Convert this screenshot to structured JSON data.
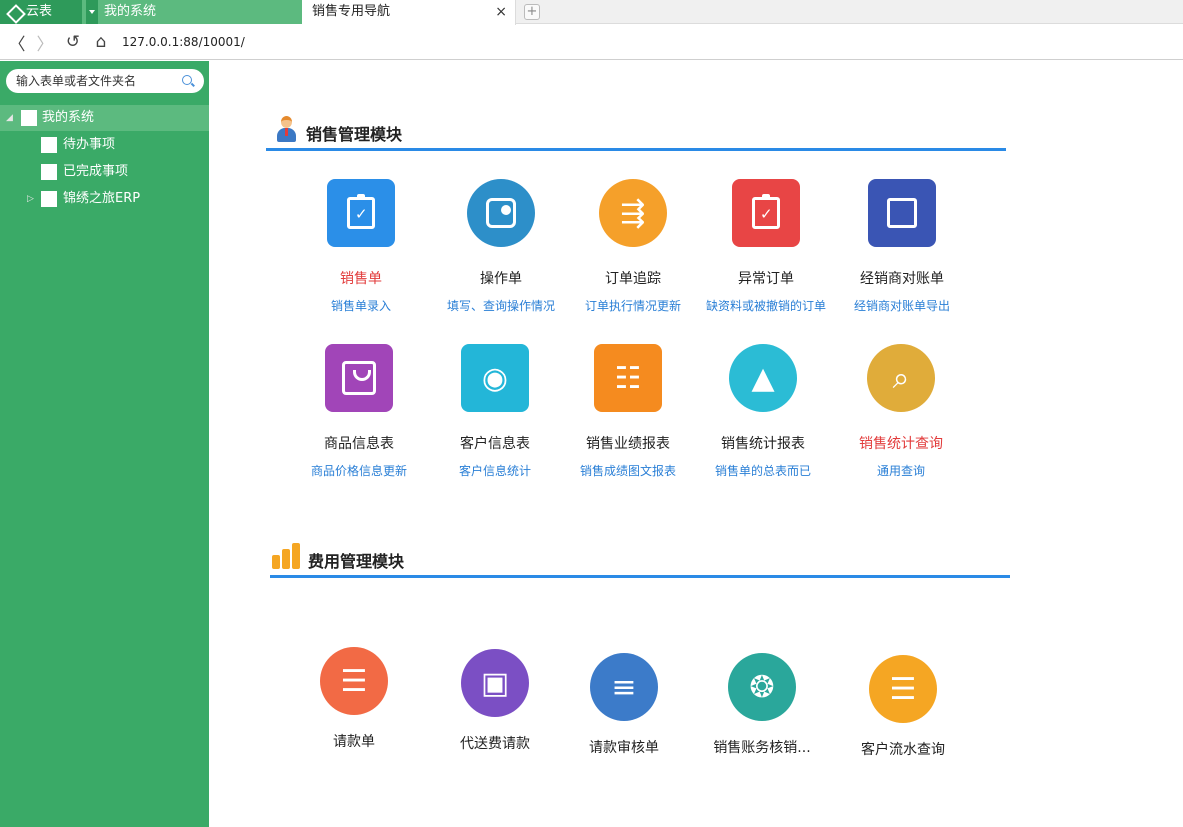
{
  "tabs": {
    "brand": "云表",
    "system_tab": "我的系统",
    "active_tab": "销售专用导航",
    "close_glyph": "×",
    "add_glyph": "+"
  },
  "address": {
    "url": "127.0.0.1:88/10001/"
  },
  "sidebar": {
    "search_placeholder": "输入表单或者文件夹名",
    "tree": [
      {
        "label": "我的系统"
      },
      {
        "label": "待办事项"
      },
      {
        "label": "已完成事项"
      },
      {
        "label": "锦绣之旅ERP"
      }
    ]
  },
  "sales_module": {
    "title": "销售管理模块",
    "tiles": [
      {
        "name": "销售单",
        "sub": "销售单录入",
        "icon": "clipboard-check-icon",
        "color": "#2b8fe8"
      },
      {
        "name": "操作单",
        "sub": "填写、查询操作情况",
        "icon": "user-card-icon",
        "color": "#2d8fc9"
      },
      {
        "name": "订单追踪",
        "sub": "订单执行情况更新",
        "icon": "running-man-icon",
        "color": "#f5a02a"
      },
      {
        "name": "异常订单",
        "sub": "缺资料或被撤销的订单",
        "icon": "return-note-icon",
        "color": "#e84545"
      },
      {
        "name": "经销商对账单",
        "sub": "经销商对账单导出",
        "icon": "document-search-icon",
        "color": "#3a55b4"
      },
      {
        "name": "商品信息表",
        "sub": "商品价格信息更新",
        "icon": "shopping-bag-icon",
        "color": "#a145b8"
      },
      {
        "name": "客户信息表",
        "sub": "客户信息统计",
        "icon": "customer-icon",
        "color": "#23b6d8"
      },
      {
        "name": "销售业绩报表",
        "sub": "销售成绩图文报表",
        "icon": "contact-card-icon",
        "color": "#f58b1f"
      },
      {
        "name": "销售统计报表",
        "sub": "销售单的总表而已",
        "icon": "tent-icon",
        "color": "#2bbcd5"
      },
      {
        "name": "销售统计查询",
        "sub": "通用查询",
        "icon": "magnifier-icon",
        "color": "#e0ac3a"
      }
    ]
  },
  "expense_module": {
    "title": "费用管理模块",
    "tiles": [
      {
        "name": "请款单",
        "icon": "cart-icon",
        "color": "#f26a45"
      },
      {
        "name": "代送费请款",
        "icon": "car-icon",
        "color": "#7b4fc4"
      },
      {
        "name": "请款审核单",
        "icon": "settings-list-icon",
        "color": "#3c7bc9"
      },
      {
        "name": "销售账务核销...",
        "icon": "medal-icon",
        "color": "#2aa79b"
      },
      {
        "name": "客户流水查询",
        "icon": "notepad-icon",
        "color": "#f5a623"
      }
    ]
  }
}
